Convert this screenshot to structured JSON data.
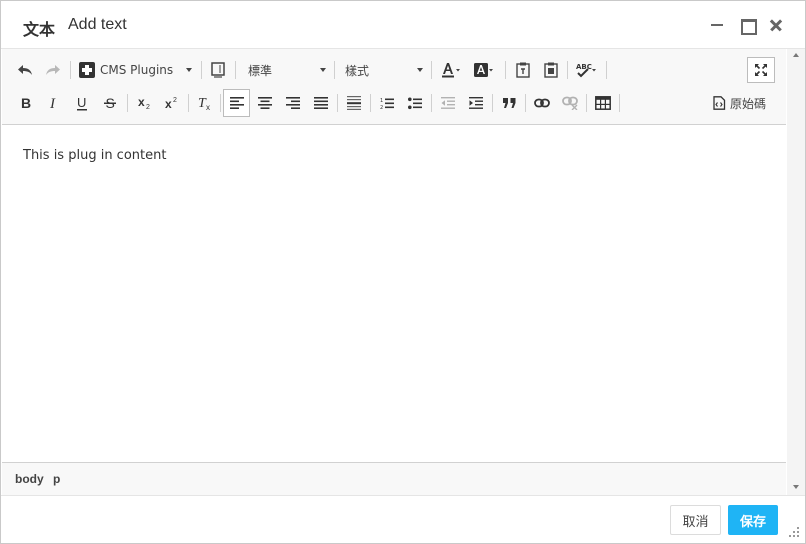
{
  "dialog": {
    "title_label": "文本",
    "title": "Add text"
  },
  "toolbar": {
    "plugins_combo": "CMS Plugins",
    "format_combo": "標準",
    "styles_combo": "樣式",
    "source_label": "原始碼"
  },
  "content": {
    "text": "This is plug in content"
  },
  "pathbar": {
    "items": [
      "body",
      "p"
    ]
  },
  "footer": {
    "cancel_label": "取消",
    "save_label": "保存"
  },
  "colors": {
    "accent": "#1fb4f5",
    "toolbar_bg": "#f8f8f8",
    "border": "#d1d1d1"
  }
}
